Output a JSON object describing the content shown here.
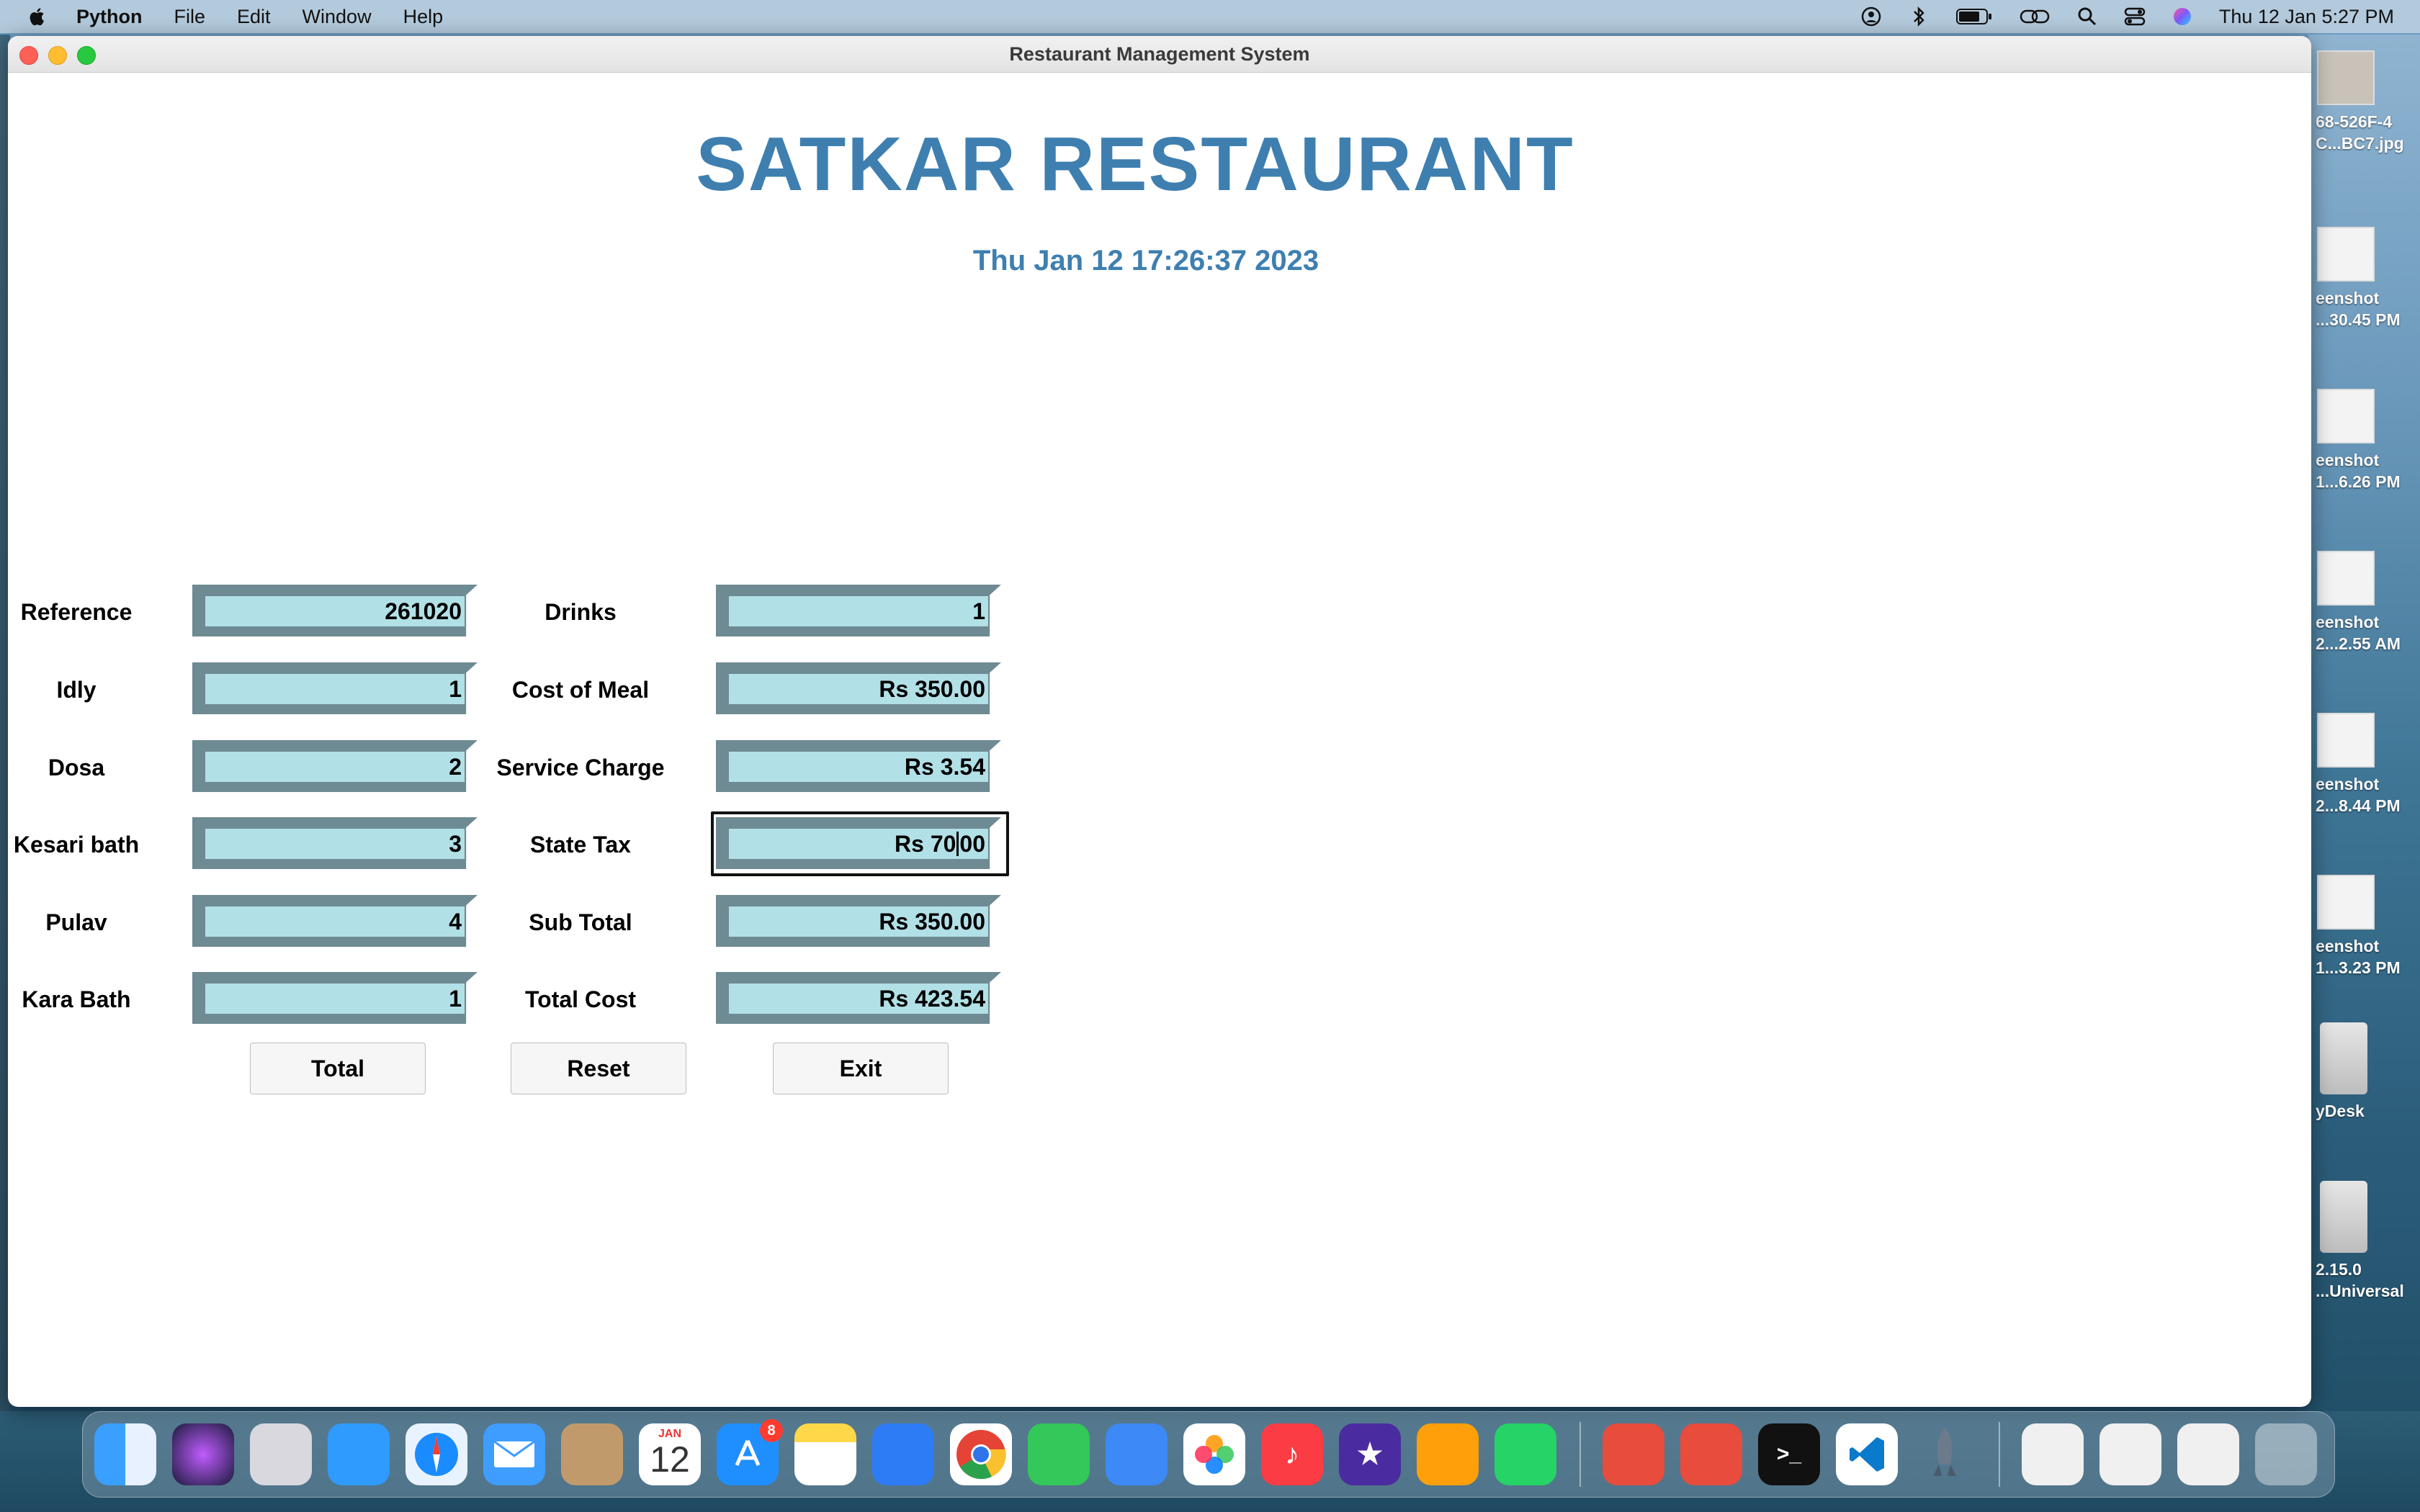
{
  "menubar": {
    "app": "Python",
    "items": [
      "File",
      "Edit",
      "Window",
      "Help"
    ],
    "clock": "Thu 12 Jan  5:27 PM",
    "status_icons": [
      "user-icon",
      "bluetooth-icon",
      "battery-icon",
      "link-icon",
      "search-icon",
      "control-center-icon",
      "siri-icon"
    ]
  },
  "window": {
    "title": "Restaurant Management System"
  },
  "app": {
    "title": "SATKAR RESTAURANT",
    "datetime": "Thu Jan 12 17:26:37 2023"
  },
  "form": {
    "left": [
      {
        "label": "Reference",
        "value": "261020"
      },
      {
        "label": "Idly",
        "value": "1"
      },
      {
        "label": "Dosa",
        "value": "2"
      },
      {
        "label": "Kesari bath",
        "value": "3"
      },
      {
        "label": "Pulav",
        "value": "4"
      },
      {
        "label": "Kara Bath",
        "value": "1"
      }
    ],
    "right": [
      {
        "label": "Drinks",
        "value": "1"
      },
      {
        "label": "Cost of Meal",
        "value": "Rs 350.00"
      },
      {
        "label": "Service Charge",
        "value": "Rs 3.54"
      },
      {
        "label": "State Tax",
        "value_before_cursor": "Rs 70",
        "value_after_cursor": "00"
      },
      {
        "label": "Sub Total",
        "value": "Rs 350.00"
      },
      {
        "label": "Total Cost",
        "value": "Rs 423.54"
      }
    ]
  },
  "buttons": {
    "total": "Total",
    "reset": "Reset",
    "exit": "Exit"
  },
  "desktop_files": [
    {
      "line1": "68-526F-4",
      "line2": "C...BC7.jpg"
    },
    {
      "line1": "eenshot",
      "line2": "...30.45 PM"
    },
    {
      "line1": "eenshot",
      "line2": "1...6.26 PM"
    },
    {
      "line1": "eenshot",
      "line2": "2...2.55 AM"
    },
    {
      "line1": "eenshot",
      "line2": "2...8.44 PM"
    },
    {
      "line1": "eenshot",
      "line2": "1...3.23 PM"
    },
    {
      "line1": "yDesk",
      "line2": ""
    },
    {
      "line1": "2.15.0",
      "line2": "...Universal"
    }
  ],
  "dock": {
    "calendar_month": "JAN",
    "calendar_day": "12",
    "appstore_badge": "8"
  }
}
